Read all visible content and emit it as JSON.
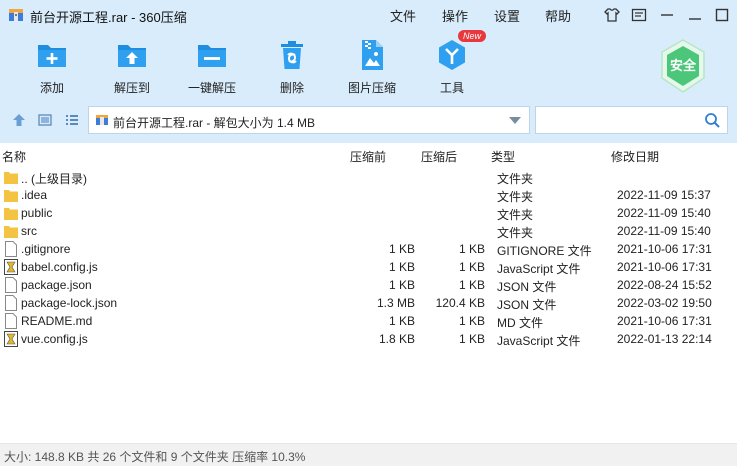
{
  "window": {
    "title": "前台开源工程.rar - 360压缩",
    "menus": [
      "文件",
      "操作",
      "设置",
      "帮助"
    ]
  },
  "toolbar": {
    "items": [
      {
        "label": "添加",
        "icon": "add-archive-icon"
      },
      {
        "label": "解压到",
        "icon": "extract-to-icon"
      },
      {
        "label": "一键解压",
        "icon": "one-click-extract-icon"
      },
      {
        "label": "删除",
        "icon": "delete-icon"
      },
      {
        "label": "图片压缩",
        "icon": "image-compress-icon"
      },
      {
        "label": "工具",
        "icon": "tools-icon"
      }
    ],
    "new_badge": "New",
    "security_label": "安全"
  },
  "address": {
    "path": "前台开源工程.rar - 解包大小为 1.4 MB",
    "search_value": ""
  },
  "columns": {
    "name": "名称",
    "size_before": "压缩前",
    "size_after": "压缩后",
    "type": "类型",
    "modified": "修改日期"
  },
  "files": [
    {
      "name": ".. (上级目录)",
      "before": "",
      "after": "",
      "type": "文件夹",
      "date": "",
      "icon": "folder-icon"
    },
    {
      "name": ".idea",
      "before": "",
      "after": "",
      "type": "文件夹",
      "date": "2022-11-09 15:37",
      "icon": "folder-icon"
    },
    {
      "name": "public",
      "before": "",
      "after": "",
      "type": "文件夹",
      "date": "2022-11-09 15:40",
      "icon": "folder-icon"
    },
    {
      "name": "src",
      "before": "",
      "after": "",
      "type": "文件夹",
      "date": "2022-11-09 15:40",
      "icon": "folder-icon"
    },
    {
      "name": ".gitignore",
      "before": "1 KB",
      "after": "1 KB",
      "type": "GITIGNORE 文件",
      "date": "2021-10-06 17:31",
      "icon": "file-icon"
    },
    {
      "name": "babel.config.js",
      "before": "1 KB",
      "after": "1 KB",
      "type": "JavaScript 文件",
      "date": "2021-10-06 17:31",
      "icon": "js-file-icon"
    },
    {
      "name": "package.json",
      "before": "1 KB",
      "after": "1 KB",
      "type": "JSON 文件",
      "date": "2022-08-24 15:52",
      "icon": "file-icon"
    },
    {
      "name": "package-lock.json",
      "before": "1.3 MB",
      "after": "120.4 KB",
      "type": "JSON 文件",
      "date": "2022-03-02 19:50",
      "icon": "file-icon"
    },
    {
      "name": "README.md",
      "before": "1 KB",
      "after": "1 KB",
      "type": "MD 文件",
      "date": "2021-10-06 17:31",
      "icon": "file-icon"
    },
    {
      "name": "vue.config.js",
      "before": "1.8 KB",
      "after": "1 KB",
      "type": "JavaScript 文件",
      "date": "2022-01-13 22:14",
      "icon": "js-file-icon"
    }
  ],
  "status": {
    "text": "大小: 148.8 KB 共 26 个文件和 9 个文件夹 压缩率 10.3%"
  },
  "colors": {
    "toolbar_bg": "#d9ecfb",
    "icon_blue": "#1e8fe0",
    "folder_yellow": "#f5c342",
    "badge_red": "#e8383d",
    "security_green": "#4cc77a"
  }
}
